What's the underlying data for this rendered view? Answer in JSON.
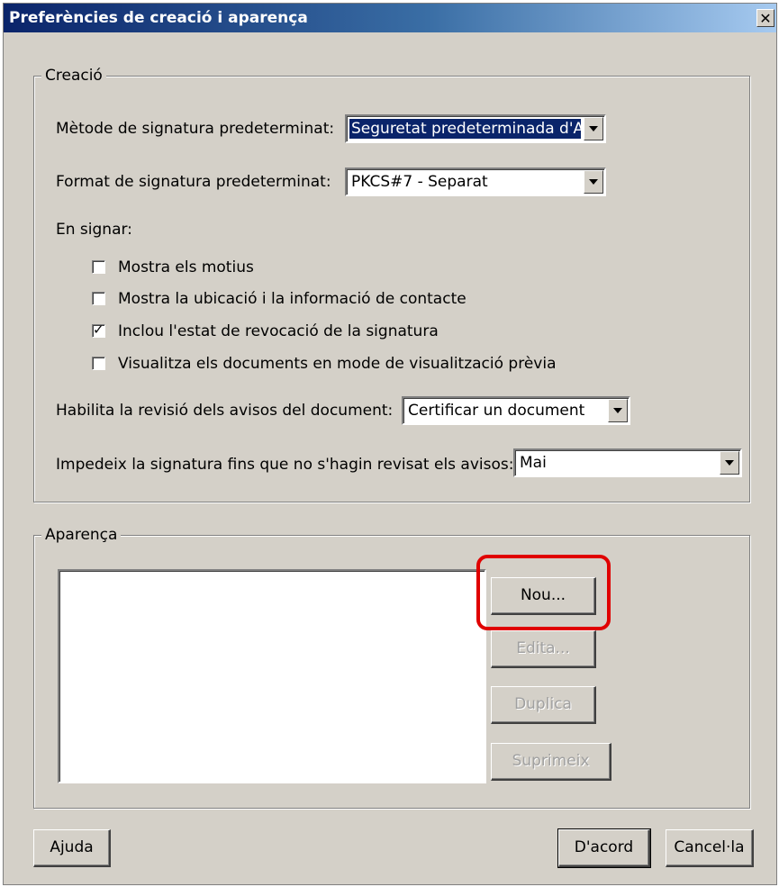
{
  "window": {
    "title": "Preferències de creació i aparença",
    "close_glyph": "✕"
  },
  "creation_group": {
    "legend": "Creació",
    "default_method_label": "Mètode de signatura predeterminat:",
    "default_method_value": "Seguretat predeterminada d'Adobe",
    "default_format_label": "Format de signatura predeterminat:",
    "default_format_value": "PKCS#7 - Separat",
    "when_signing_label": "En signar:",
    "options": [
      {
        "label": "Mostra els motius",
        "checked": false
      },
      {
        "label": "Mostra la ubicació i la informació de contacte",
        "checked": false
      },
      {
        "label": "Inclou l'estat de revocació de la signatura",
        "checked": true
      },
      {
        "label": "Visualitza els documents en mode de visualització prèvia",
        "checked": false
      }
    ],
    "check_glyph": "✓",
    "review_warnings_label": "Habilita la revisió dels avisos del document:",
    "review_warnings_value": "Certificar un document",
    "prevent_signing_label": "Impedeix la signatura fins que no s'hagin revisat els avisos:",
    "prevent_signing_value": "Mai"
  },
  "appearance_group": {
    "legend": "Aparença",
    "buttons": {
      "new": "Nou...",
      "edit": "Edita...",
      "duplicate": "Duplica",
      "delete": "Suprimeix"
    }
  },
  "footer": {
    "help": "Ajuda",
    "ok": "D'acord",
    "cancel": "Cancel·la"
  },
  "colors": {
    "title_bar": "#0a246a",
    "dialog_bg": "#d4d0c8",
    "highlight": "#e00000"
  }
}
